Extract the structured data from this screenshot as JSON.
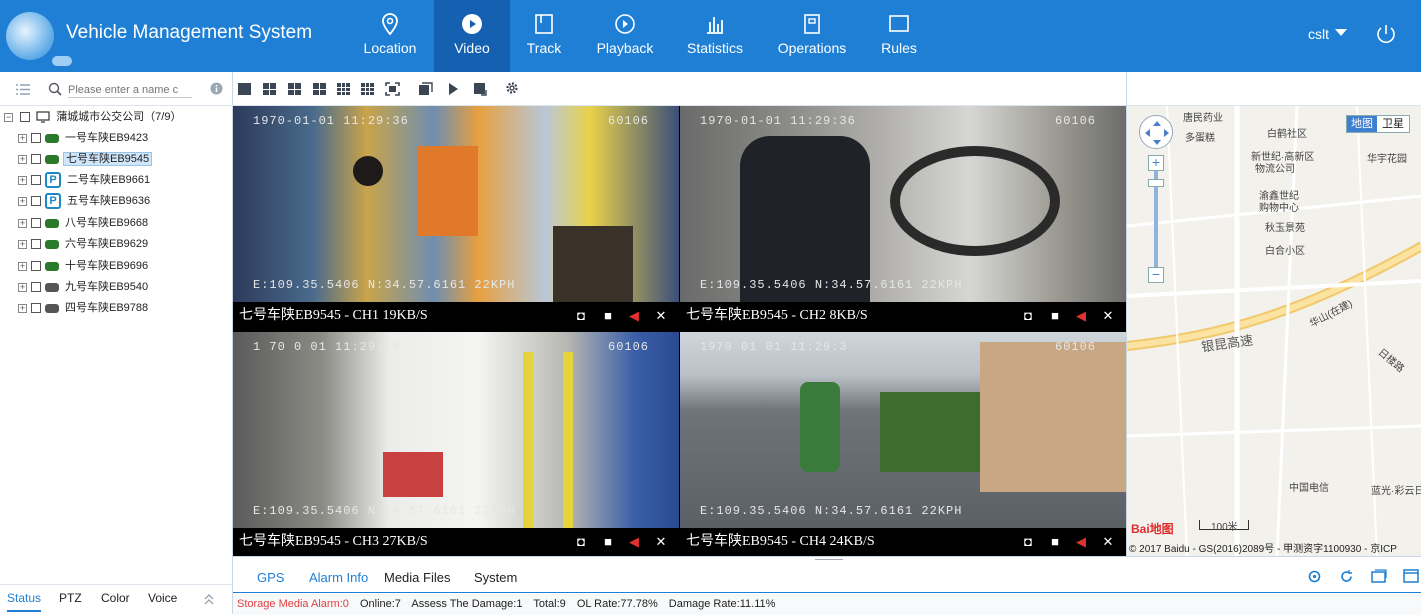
{
  "app_title": "Vehicle Management System",
  "nav": [
    {
      "label": "Location",
      "icon": "location-pin-icon"
    },
    {
      "label": "Video",
      "icon": "play-circle-icon",
      "active": true
    },
    {
      "label": "Track",
      "icon": "track-icon"
    },
    {
      "label": "Playback",
      "icon": "playback-icon"
    },
    {
      "label": "Statistics",
      "icon": "bar-chart-icon"
    },
    {
      "label": "Operations",
      "icon": "operations-icon"
    },
    {
      "label": "Rules",
      "icon": "rules-icon"
    }
  ],
  "user": {
    "name": "cslt"
  },
  "search": {
    "placeholder": "Please enter a name c"
  },
  "tree": {
    "root": "蒲城城市公交公司（7/9）",
    "vehicles": [
      {
        "name": "一号车陕EB9423",
        "status": "online"
      },
      {
        "name": "七号车陕EB9545",
        "status": "online",
        "selected": true
      },
      {
        "name": "二号车陕EB9661",
        "status": "parked"
      },
      {
        "name": "五号车陕EB9636",
        "status": "parked"
      },
      {
        "name": "八号车陕EB9668",
        "status": "online"
      },
      {
        "name": "六号车陕EB9629",
        "status": "online"
      },
      {
        "name": "十号车陕EB9696",
        "status": "online"
      },
      {
        "name": "九号车陕EB9540",
        "status": "offline"
      },
      {
        "name": "四号车陕EB9788",
        "status": "offline"
      }
    ]
  },
  "left_tabs": [
    "Status",
    "PTZ",
    "Color",
    "Voice"
  ],
  "channels": [
    {
      "label": "七号车陕EB9545 - CH1 19KB/S",
      "date": "1970-01-01 11:29:36",
      "id": "60106",
      "gps": "E:109.35.5406 N:34.57.6161 22KPH"
    },
    {
      "label": "七号车陕EB9545 - CH2 8KB/S",
      "date": "1970-01-01 11:29:36",
      "id": "60106",
      "gps": "E:109.35.5406 N:34.57.6161 22KPH"
    },
    {
      "label": "七号车陕EB9545 - CH3 27KB/S",
      "date": "1 70 0 01 11:29:35",
      "id": "60106",
      "gps": "E:109.35.5406 N:34.57.6161 22KPH"
    },
    {
      "label": "七号车陕EB9545 - CH4 24KB/S",
      "date": "1970 01 01 11:29:3",
      "id": "60106",
      "gps": "E:109.35.5406 N:34.57.6161 22KPH"
    }
  ],
  "map": {
    "tabs": [
      "地图",
      "卫星"
    ],
    "labels": [
      "唐民药业",
      "多蛋糕",
      "白鹤社区",
      "新世纪·高新区",
      "物流公司",
      "华宇花园",
      "渝鑫世纪",
      "购物中心",
      "秋玉景苑",
      "白合小区",
      "银昆高速",
      "华山(在建)",
      "日楼路",
      "中国电信",
      "蓝光·彩云日"
    ],
    "scale": "100米",
    "copyright": "© 2017 Baidu - GS(2016)2089号 - 甲测资字1100930 - 京ICP",
    "logo": "Bai地图"
  },
  "bottom_tabs": [
    "GPS",
    "Alarm Info",
    "Media Files",
    "System"
  ],
  "status_bar": {
    "alarm": "Storage Media Alarm:0",
    "online": "Online:7",
    "damage": "Assess The Damage:1",
    "total": "Total:9",
    "ol_rate": "OL Rate:77.78%",
    "damage_rate": "Damage Rate:11.11%"
  },
  "colors": {
    "header": "#1f7fd4",
    "accent": "#1f7fd4",
    "alarm": "#e04040"
  }
}
